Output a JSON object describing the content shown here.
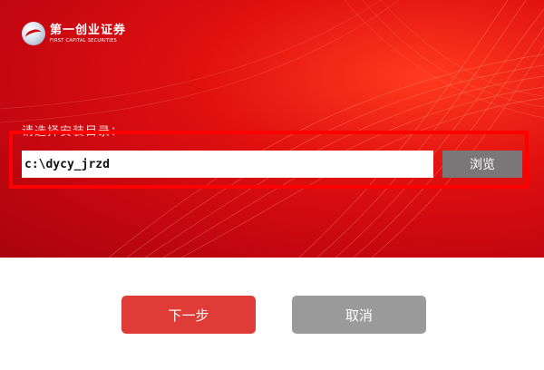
{
  "logo": {
    "name_cn": "第一创业证券",
    "name_en": "FIRST CAPITAL SECURITIES"
  },
  "install": {
    "prompt": "请选择安装目录：",
    "path_value": "c:\\dycy_jrzd",
    "browse_label": "浏览"
  },
  "actions": {
    "next_label": "下一步",
    "cancel_label": "取消"
  },
  "colors": {
    "brand_red": "#c50710",
    "highlight_border": "#ff0000",
    "next_button": "#df3c37",
    "cancel_button": "#9a9a9a",
    "browse_button": "#7b7778"
  }
}
